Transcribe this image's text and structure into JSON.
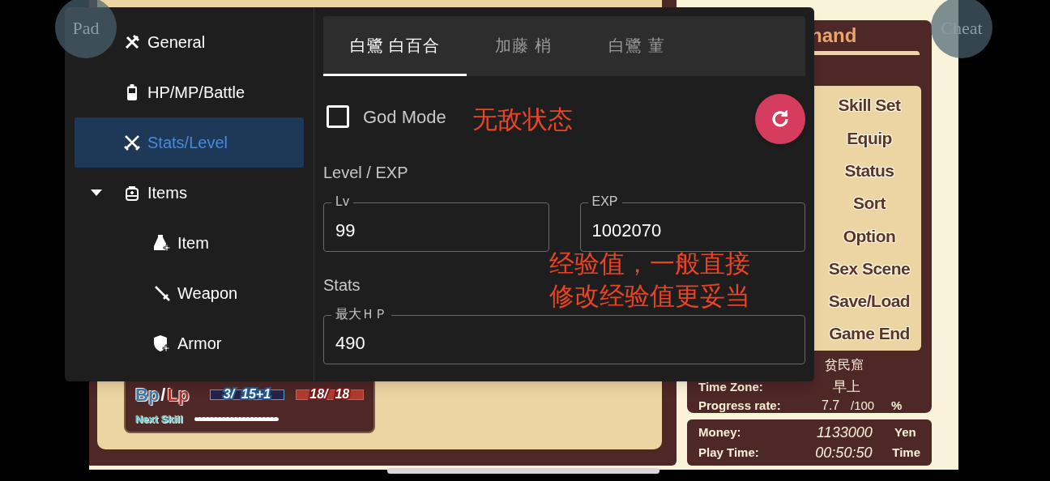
{
  "game": {
    "title_fragment": "nand",
    "command_menu": [
      "Skill Set",
      "Equip",
      "Status",
      "Sort",
      "Option",
      "Sex Scene",
      "Save/Load",
      "Game End"
    ],
    "location": "贫民窟",
    "time_zone": {
      "label": "Time Zone:",
      "value": "早上"
    },
    "progress": {
      "label": "Progress rate:",
      "value": "7.7",
      "max": "/100",
      "unit": "%"
    },
    "money": {
      "label": "Money:",
      "value": "1133000",
      "unit": "Yen"
    },
    "play_time": {
      "label": "Play Time:",
      "value": "00:50:50",
      "unit": "Time"
    },
    "character": {
      "bp_label": "Bp",
      "separator": "/",
      "lp_label": "Lp",
      "bp_value": "3/  15+1",
      "lp_value": "18/  18",
      "next_skill": "Next Skill"
    }
  },
  "floating_buttons": [
    {
      "label": "Pad"
    },
    {
      "label": "Cheat"
    }
  ],
  "cheat_panel": {
    "sidebar": [
      {
        "label": "General",
        "kind": "tools",
        "selected": false
      },
      {
        "label": "HP/MP/Battle",
        "kind": "battery",
        "selected": false
      },
      {
        "label": "Stats/Level",
        "kind": "swords",
        "selected": true
      },
      {
        "label": "Items",
        "kind": "bag",
        "selected": false,
        "expanded": true,
        "children": [
          {
            "label": "Item",
            "kind": "potion",
            "selected": false
          },
          {
            "label": "Weapon",
            "kind": "sword",
            "selected": false
          },
          {
            "label": "Armor",
            "kind": "shield",
            "selected": false
          }
        ]
      }
    ],
    "tabs": [
      {
        "label": "白鷺 白百合",
        "selected": true
      },
      {
        "label": "加藤 梢",
        "selected": false
      },
      {
        "label": "白鷺 菫",
        "selected": false
      }
    ],
    "god_mode": {
      "label": "God Mode",
      "checked": false
    },
    "sections": [
      {
        "title": "Level / EXP",
        "fields": [
          {
            "label": "Lv",
            "value": "99"
          },
          {
            "label": "EXP",
            "value": "1002070"
          }
        ]
      },
      {
        "title": "Stats",
        "fields": [
          {
            "label": "最大ＨＰ",
            "value": "490"
          }
        ]
      }
    ]
  },
  "annotations": [
    {
      "text": "无敌状态"
    },
    {
      "text": "经验值，一般直接"
    },
    {
      "text": "修改经验值更妥当"
    }
  ]
}
